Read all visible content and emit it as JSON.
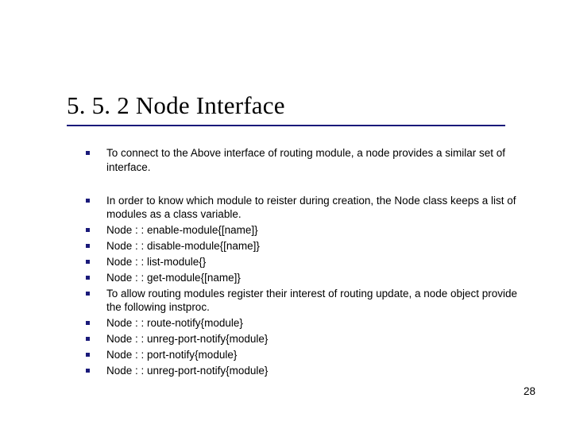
{
  "title": "5. 5. 2  Node Interface",
  "bullets": [
    {
      "text": "To connect to the Above interface of routing module, a node provides a similar set of interface.",
      "spaced": true
    },
    {
      "text": "In order to know which module to reister during creation, the Node class keeps a list of modules as a class variable.",
      "spaced": false
    },
    {
      "text": "Node : : enable-module{[name]}",
      "spaced": false
    },
    {
      "text": "Node : : disable-module{[name]}",
      "spaced": false
    },
    {
      "text": "Node : : list-module{}",
      "spaced": false
    },
    {
      "text": "Node : : get-module{[name]}",
      "spaced": false
    },
    {
      "text": "To allow routing modules register their interest of routing update, a node object provide the following instproc.",
      "spaced": false
    },
    {
      "text": "Node : : route-notify{module}",
      "spaced": false
    },
    {
      "text": "Node : : unreg-port-notify{module}",
      "spaced": false
    },
    {
      "text": "Node : : port-notify{module}",
      "spaced": false
    },
    {
      "text": "Node : : unreg-port-notify{module}",
      "spaced": false
    }
  ],
  "page_number": "28"
}
